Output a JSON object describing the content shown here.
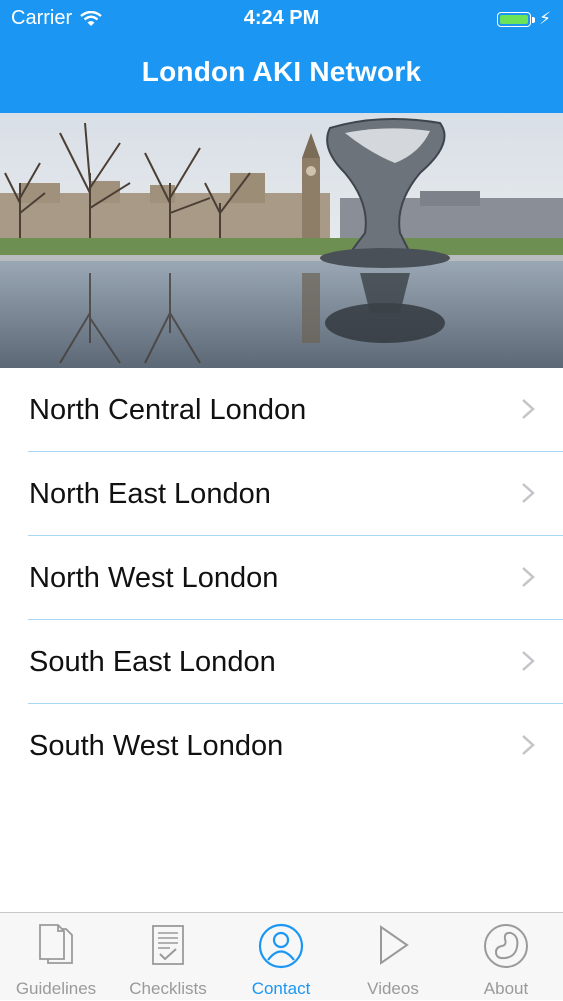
{
  "status_bar": {
    "carrier": "Carrier",
    "time": "4:24 PM",
    "icons": [
      "wifi-icon",
      "battery-icon",
      "charging-bolt-icon"
    ]
  },
  "nav": {
    "title": "London AKI Network"
  },
  "hero": {
    "description_icon": "westminster-photo"
  },
  "regions": [
    {
      "label": "North Central London"
    },
    {
      "label": "North East London"
    },
    {
      "label": "North West London"
    },
    {
      "label": "South East London"
    },
    {
      "label": "South West London"
    }
  ],
  "tabbar": {
    "tabs": [
      {
        "label": "Guidelines",
        "icon": "documents-icon",
        "active": false
      },
      {
        "label": "Checklists",
        "icon": "checklist-icon",
        "active": false
      },
      {
        "label": "Contact",
        "icon": "contact-person-icon",
        "active": true
      },
      {
        "label": "Videos",
        "icon": "play-icon",
        "active": false
      },
      {
        "label": "About",
        "icon": "kidney-icon",
        "active": false
      }
    ]
  },
  "colors": {
    "accent": "#1b97f3",
    "separator": "#a9d8f5",
    "inactive_tab": "#9a9a9a"
  }
}
